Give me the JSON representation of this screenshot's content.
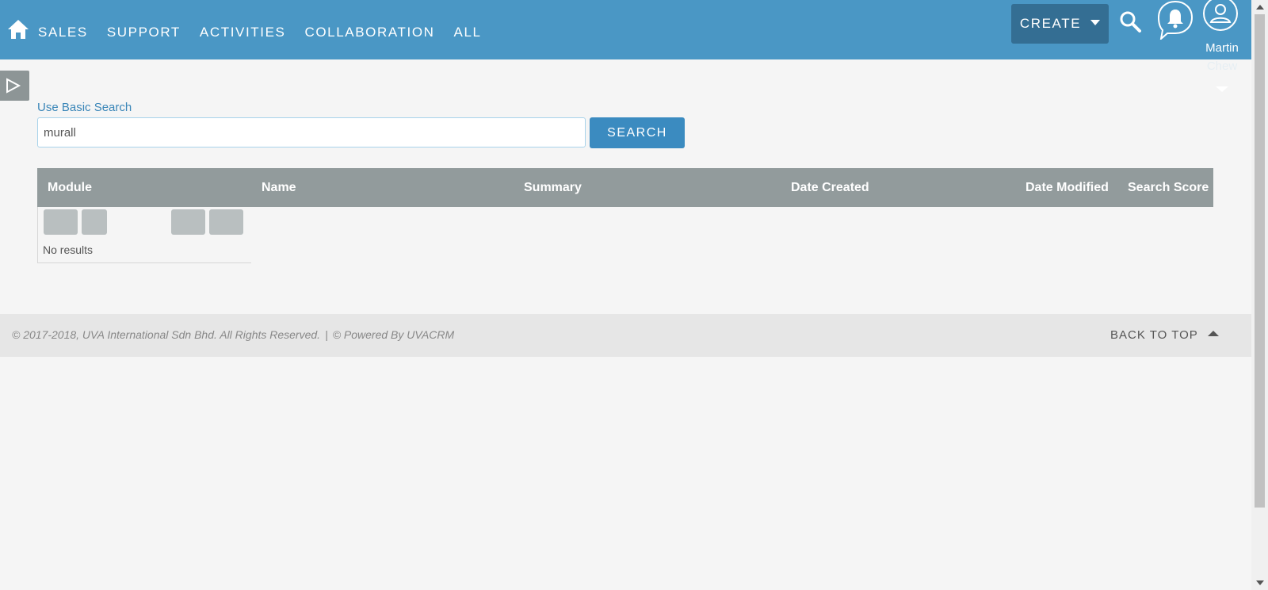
{
  "nav": {
    "items": [
      {
        "label": "SALES"
      },
      {
        "label": "SUPPORT"
      },
      {
        "label": "ACTIVITIES"
      },
      {
        "label": "COLLABORATION"
      },
      {
        "label": "ALL"
      }
    ],
    "create_label": "CREATE",
    "user": {
      "first_name": "Martin",
      "last_name": "Chew"
    },
    "icons": {
      "home": "home-icon",
      "search": "search-icon",
      "notifications": "bell-icon",
      "user": "user-avatar-icon"
    }
  },
  "search": {
    "basic_link": "Use Basic Search",
    "query": "murall",
    "button_label": "SEARCH"
  },
  "results": {
    "columns": [
      "Module",
      "Name",
      "Summary",
      "Date Created",
      "Date Modified",
      "Search Score"
    ],
    "empty_text": "No results"
  },
  "footer": {
    "copyright": "© 2017-2018, UVA International Sdn Bhd. All Rights Reserved.",
    "separator": "|",
    "powered": "© Powered By UVACRM",
    "back_to_top": "BACK TO TOP"
  },
  "colors": {
    "nav_bg": "#4a97c5",
    "create_bg": "#346e93",
    "table_header_bg": "#929b9c",
    "search_button_bg": "#3b8bc0"
  }
}
